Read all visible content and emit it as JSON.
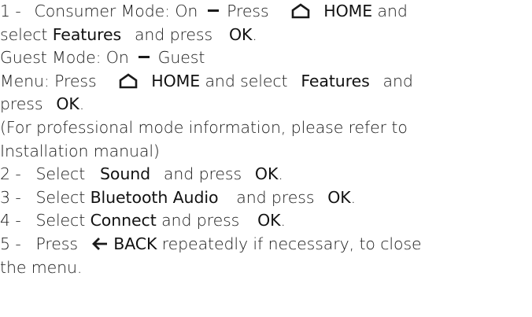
{
  "steps": {
    "s1": {
      "num": "1 -",
      "mode": "Consumer Mode: On",
      "press": "Press",
      "home": "HOME",
      "and": "and",
      "select": "select",
      "features": "Features",
      "and_press": "and press",
      "ok": "OK",
      "period": "."
    },
    "guest": {
      "mode": "Guest Mode: On",
      "guest": "Guest",
      "menu_press": "Menu: Press",
      "home": "HOME",
      "and_select": "and select",
      "features": "Features",
      "and": "and",
      "press": "press",
      "ok": "OK",
      "period": "."
    },
    "note": {
      "line1": "(For professional mode information, please refer to",
      "line2": "Installation manual)"
    },
    "s2": {
      "num": "2 -",
      "select": "Select",
      "item": "Sound",
      "and_press": "and press",
      "ok": "OK",
      "period": "."
    },
    "s3": {
      "num": "3 -",
      "select": "Select",
      "item": "Bluetooth Audio",
      "and_press": "and press",
      "ok": "OK",
      "period": "."
    },
    "s4": {
      "num": "4 -",
      "select": "Select",
      "item": "Connect",
      "and_press": "and press",
      "ok": "OK",
      "period": "."
    },
    "s5": {
      "num": "5 -",
      "press": "Press",
      "back": "BACK",
      "rest": "repeatedly if necessary, to close",
      "line2": "the menu."
    }
  },
  "icons": {
    "home": "home-icon",
    "back": "back-arrow-icon",
    "dash": "dash-icon"
  }
}
